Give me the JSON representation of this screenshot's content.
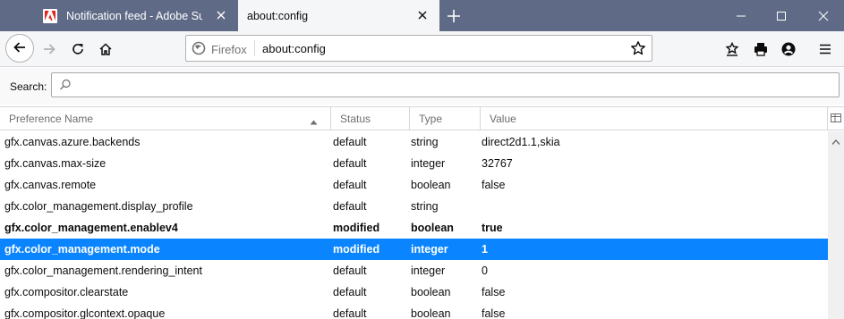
{
  "tabs": [
    {
      "title": "Notification feed - Adobe Support",
      "active": false
    },
    {
      "title": "about:config",
      "active": true
    }
  ],
  "navbar": {
    "identity_label": "Firefox",
    "url": "about:config"
  },
  "search": {
    "label": "Search:",
    "value": ""
  },
  "columns": {
    "name": "Preference Name",
    "status": "Status",
    "type": "Type",
    "value": "Value"
  },
  "prefs": [
    {
      "name": "gfx.canvas.azure.backends",
      "status": "default",
      "type": "string",
      "value": "direct2d1.1,skia"
    },
    {
      "name": "gfx.canvas.max-size",
      "status": "default",
      "type": "integer",
      "value": "32767"
    },
    {
      "name": "gfx.canvas.remote",
      "status": "default",
      "type": "boolean",
      "value": "false"
    },
    {
      "name": "gfx.color_management.display_profile",
      "status": "default",
      "type": "string",
      "value": ""
    },
    {
      "name": "gfx.color_management.enablev4",
      "status": "modified",
      "type": "boolean",
      "value": "true"
    },
    {
      "name": "gfx.color_management.mode",
      "status": "modified",
      "type": "integer",
      "value": "1"
    },
    {
      "name": "gfx.color_management.rendering_intent",
      "status": "default",
      "type": "integer",
      "value": "0"
    },
    {
      "name": "gfx.compositor.clearstate",
      "status": "default",
      "type": "boolean",
      "value": "false"
    },
    {
      "name": "gfx.compositor.glcontext.opaque",
      "status": "default",
      "type": "boolean",
      "value": "false"
    }
  ],
  "selected_pref": "gfx.color_management.mode",
  "colors": {
    "tabstrip": "#5f6b86",
    "selection": "#0a84ff",
    "adobe_red": "#e1251b"
  },
  "icons": [
    "adobe-icon",
    "close-icon",
    "plus-icon",
    "minimize-icon",
    "maximize-icon",
    "back-icon",
    "forward-icon",
    "reload-icon",
    "home-icon",
    "firefox-icon",
    "bookmark-star-icon",
    "library-icon",
    "print-icon",
    "account-icon",
    "menu-icon",
    "search-icon",
    "sort-ascending-icon",
    "column-picker-icon",
    "scroll-up-icon"
  ]
}
